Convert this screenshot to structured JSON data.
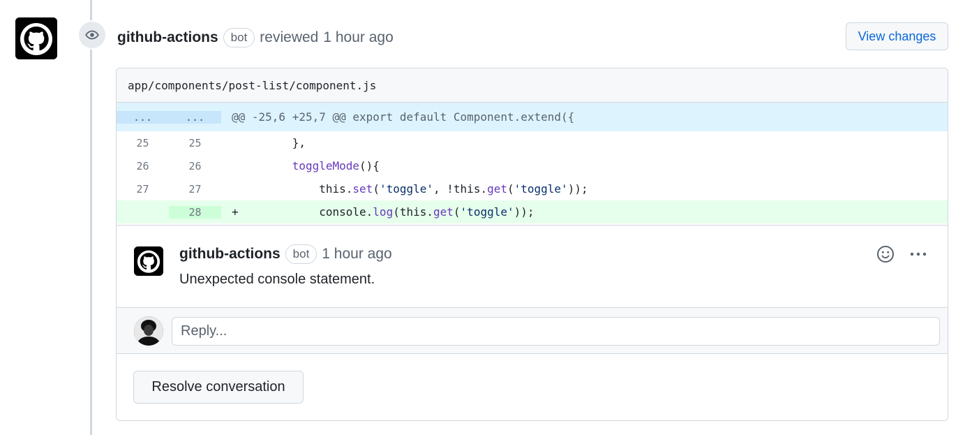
{
  "review": {
    "author": "github-actions",
    "badge": "bot",
    "action": "reviewed",
    "time": "1 hour ago",
    "view_changes_label": "View changes"
  },
  "diff": {
    "file_path": "app/components/post-list/component.js",
    "hunk": {
      "old_marker": "...",
      "new_marker": "...",
      "header": "@@ -25,6 +25,7 @@ export default Component.extend({"
    },
    "lines": [
      {
        "old": "25",
        "new": "25",
        "sign": " ",
        "text": "        },"
      },
      {
        "old": "26",
        "new": "26",
        "sign": " ",
        "text": "        toggleMode(){"
      },
      {
        "old": "27",
        "new": "27",
        "sign": " ",
        "text": "            this.set('toggle', !this.get('toggle'));"
      },
      {
        "old": "",
        "new": "28",
        "sign": "+",
        "text": "            console.log(this.get('toggle'));"
      }
    ]
  },
  "comment": {
    "author": "github-actions",
    "badge": "bot",
    "time": "1 hour ago",
    "body": "Unexpected console statement.",
    "more_label": "···"
  },
  "reply": {
    "placeholder": "Reply..."
  },
  "resolve_label": "Resolve conversation",
  "colors": {
    "link": "#0969da",
    "hunk_bg": "#ddf4ff",
    "added_bg": "#e6ffec",
    "border": "#d0d7de"
  },
  "icons": {
    "avatar": "github-mark-icon",
    "review_state": "eye-icon",
    "emoji": "smiley-icon",
    "more": "kebab-horizontal-icon"
  }
}
